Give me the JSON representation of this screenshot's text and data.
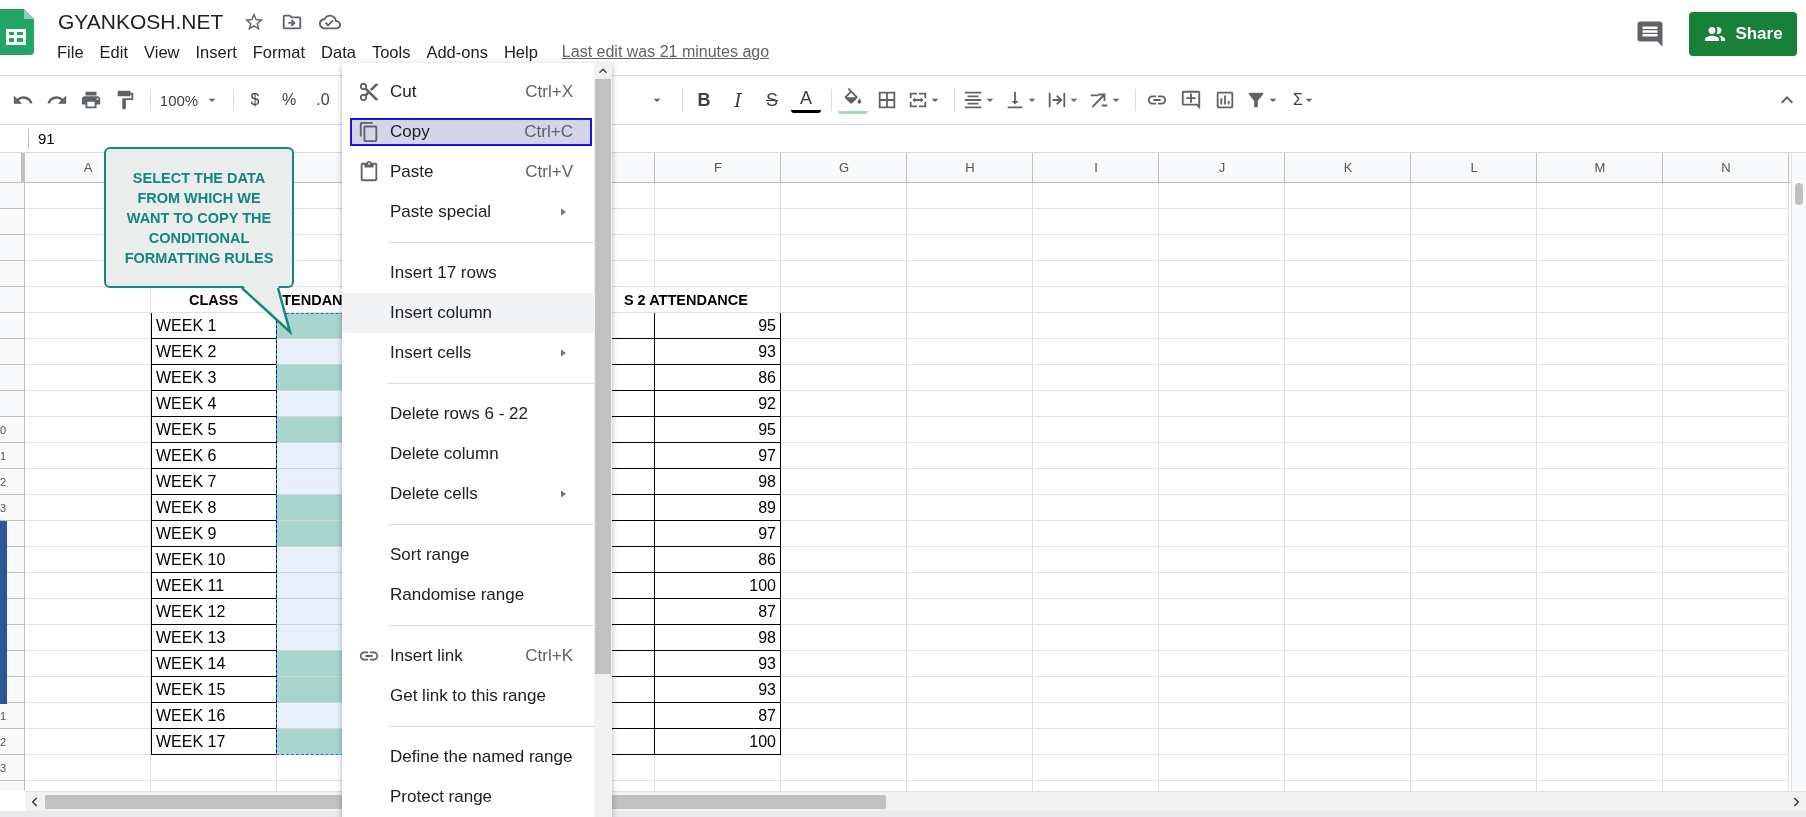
{
  "doc": {
    "title": "GYANKOSH.NET"
  },
  "menubar": [
    "File",
    "Edit",
    "View",
    "Insert",
    "Format",
    "Data",
    "Tools",
    "Add-ons",
    "Help"
  ],
  "last_edit": "Last edit was 21 minutes ago",
  "share": "Share",
  "toolbar": {
    "zoom": "100%",
    "currency": "$",
    "percent": "%",
    "decimal": ".0",
    "bold": "B",
    "italic": "I",
    "strike": "S",
    "text_color": "A",
    "functions": "Σ"
  },
  "formula": {
    "value": "91"
  },
  "column_headers": [
    "A",
    "F",
    "G",
    "H",
    "I",
    "J",
    "K",
    "L",
    "M",
    "N"
  ],
  "sheet": {
    "header": {
      "part_1": "CLASS",
      "part_2": "TENDAN",
      "part_3": "S 2 ATTENDANCE"
    },
    "rows": [
      {
        "week": "WEEK 1",
        "color": "#a8d5cc",
        "value": "95",
        "marked": false
      },
      {
        "week": "WEEK 2",
        "color": "#e8f0fe",
        "value": "93",
        "marked": false
      },
      {
        "week": "WEEK 3",
        "color": "#a8d5cc",
        "value": "86",
        "marked": false
      },
      {
        "week": "WEEK 4",
        "color": "#e8f0fe",
        "value": "92",
        "marked": false
      },
      {
        "row_label": "0",
        "week": "WEEK 5",
        "color": "#a8d5cc",
        "value": "95",
        "marked": false
      },
      {
        "row_label": "1",
        "week": "WEEK 6",
        "color": "#e8f0fe",
        "value": "97",
        "marked": false
      },
      {
        "row_label": "2",
        "week": "WEEK 7",
        "color": "#e8f0fe",
        "value": "98",
        "marked": false
      },
      {
        "row_label": "3",
        "week": "WEEK 8",
        "color": "#a8d5cc",
        "value": "89",
        "marked": false
      },
      {
        "week": "WEEK 9",
        "color": "#a8d5cc",
        "value": "97",
        "marked": true
      },
      {
        "week": "WEEK 10",
        "color": "#e8f0fe",
        "value": "86",
        "marked": true
      },
      {
        "week": "WEEK 11",
        "color": "#e8f0fe",
        "value": "100",
        "marked": true
      },
      {
        "week": "WEEK 12",
        "color": "#e8f0fe",
        "value": "87",
        "marked": true
      },
      {
        "week": "WEEK 13",
        "color": "#e8f0fe",
        "value": "98",
        "marked": true
      },
      {
        "week": "WEEK 14",
        "color": "#a8d5cc",
        "value": "93",
        "marked": true
      },
      {
        "week": "WEEK 15",
        "color": "#a8d5cc",
        "value": "93",
        "marked": true
      },
      {
        "row_label": "1",
        "week": "WEEK 16",
        "color": "#e8f0fe",
        "value": "87",
        "marked": false
      },
      {
        "row_label": "2",
        "week": "WEEK 17",
        "color": "#a8d5cc",
        "value": "100",
        "marked": false
      }
    ],
    "trailing_row_label": "3"
  },
  "callout": "SELECT THE DATA FROM WHICH WE WANT TO COPY THE CONDITIONAL FORMATTING RULES",
  "context_menu": [
    {
      "kind": "icon_item",
      "label": "Cut",
      "shortcut": "Ctrl+X",
      "selected": false,
      "hovered": false,
      "submenu": false
    },
    {
      "kind": "icon_item",
      "label": "Copy",
      "shortcut": "Ctrl+C",
      "selected": true,
      "hovered": false,
      "submenu": false
    },
    {
      "kind": "icon_item",
      "label": "Paste",
      "shortcut": "Ctrl+V",
      "selected": false,
      "hovered": false,
      "submenu": false
    },
    {
      "kind": "item",
      "label": "Paste special",
      "selected": false,
      "hovered": false,
      "submenu": true
    },
    {
      "kind": "separator"
    },
    {
      "kind": "item",
      "label": "Insert 17 rows",
      "selected": false,
      "hovered": false,
      "submenu": false
    },
    {
      "kind": "item",
      "label": "Insert column",
      "selected": false,
      "hovered": true,
      "submenu": false
    },
    {
      "kind": "item",
      "label": "Insert cells",
      "selected": false,
      "hovered": false,
      "submenu": true
    },
    {
      "kind": "separator"
    },
    {
      "kind": "item",
      "label": "Delete rows 6 - 22",
      "selected": false,
      "hovered": false,
      "submenu": false
    },
    {
      "kind": "item",
      "label": "Delete column",
      "selected": false,
      "hovered": false,
      "submenu": false
    },
    {
      "kind": "item",
      "label": "Delete cells",
      "selected": false,
      "hovered": false,
      "submenu": true
    },
    {
      "kind": "separator"
    },
    {
      "kind": "item",
      "label": "Sort range",
      "selected": false,
      "hovered": false,
      "submenu": false
    },
    {
      "kind": "item",
      "label": "Randomise range",
      "selected": false,
      "hovered": false,
      "submenu": false
    },
    {
      "kind": "separator"
    },
    {
      "kind": "icon_item",
      "label": "Insert link",
      "shortcut": "Ctrl+K",
      "selected": false,
      "hovered": false,
      "submenu": false
    },
    {
      "kind": "item",
      "label": "Get link to this range",
      "selected": false,
      "hovered": false,
      "submenu": false
    },
    {
      "kind": "separator"
    },
    {
      "kind": "item",
      "label": "Define the named range",
      "selected": false,
      "hovered": false,
      "submenu": false
    },
    {
      "kind": "item",
      "label": "Protect range",
      "selected": false,
      "hovered": false,
      "submenu": false
    }
  ]
}
